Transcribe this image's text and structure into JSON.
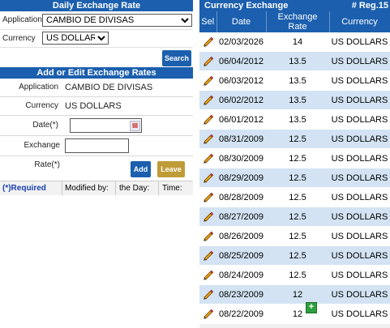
{
  "filter": {
    "title": "Daily Exchange Rate",
    "application_label": "Application",
    "application_value": "CAMBIO DE DIVISAS",
    "currency_label": "Currency",
    "currency_value": "US DOLLARS",
    "search_label": "Search"
  },
  "editor": {
    "title": "Add or Edit Exchange Rates",
    "application_label": "Application",
    "application_value": "CAMBIO DE DIVISAS",
    "currency_label": "Currency",
    "currency_value": "US DOLLARS",
    "date_label": "Date(*)",
    "date_value": "",
    "rate_label": "Exchange Rate(*)",
    "rate_value": "",
    "add_label": "Add",
    "leave_label": "Leave",
    "required_label": "(*)Required",
    "modified_by_label": "Modified by:",
    "the_day_label": "the Day:",
    "time_label": "Time:"
  },
  "grid": {
    "title": "Currency Exchange",
    "record_count": "# Reg.15",
    "columns": [
      "Sel",
      "Date",
      "Exchange Rate",
      "Currency"
    ],
    "rows": [
      {
        "date": "02/03/2026",
        "rate": "14",
        "currency": "US DOLLARS"
      },
      {
        "date": "06/04/2012",
        "rate": "13.5",
        "currency": "US DOLLARS"
      },
      {
        "date": "06/03/2012",
        "rate": "13.5",
        "currency": "US DOLLARS"
      },
      {
        "date": "06/02/2012",
        "rate": "13.5",
        "currency": "US DOLLARS"
      },
      {
        "date": "06/01/2012",
        "rate": "13.5",
        "currency": "US DOLLARS"
      },
      {
        "date": "08/31/2009",
        "rate": "12.5",
        "currency": "US DOLLARS"
      },
      {
        "date": "08/30/2009",
        "rate": "12.5",
        "currency": "US DOLLARS"
      },
      {
        "date": "08/29/2009",
        "rate": "12.5",
        "currency": "US DOLLARS"
      },
      {
        "date": "08/28/2009",
        "rate": "12.5",
        "currency": "US DOLLARS"
      },
      {
        "date": "08/27/2009",
        "rate": "12.5",
        "currency": "US DOLLARS"
      },
      {
        "date": "08/26/2009",
        "rate": "12.5",
        "currency": "US DOLLARS"
      },
      {
        "date": "08/25/2009",
        "rate": "12.5",
        "currency": "US DOLLARS"
      },
      {
        "date": "08/24/2009",
        "rate": "12.5",
        "currency": "US DOLLARS"
      },
      {
        "date": "08/23/2009",
        "rate": "12",
        "currency": "US DOLLARS"
      },
      {
        "date": "08/22/2009",
        "rate": "12",
        "currency": "US DOLLARS"
      }
    ],
    "row_icon": "pencil-icon",
    "add_icon": "plus-icon"
  },
  "colors": {
    "header_blue": "#1b5fae",
    "row_alt": "#d3e3f3",
    "leave_gold": "#bf9c37",
    "add_green": "#2e9e3e"
  }
}
